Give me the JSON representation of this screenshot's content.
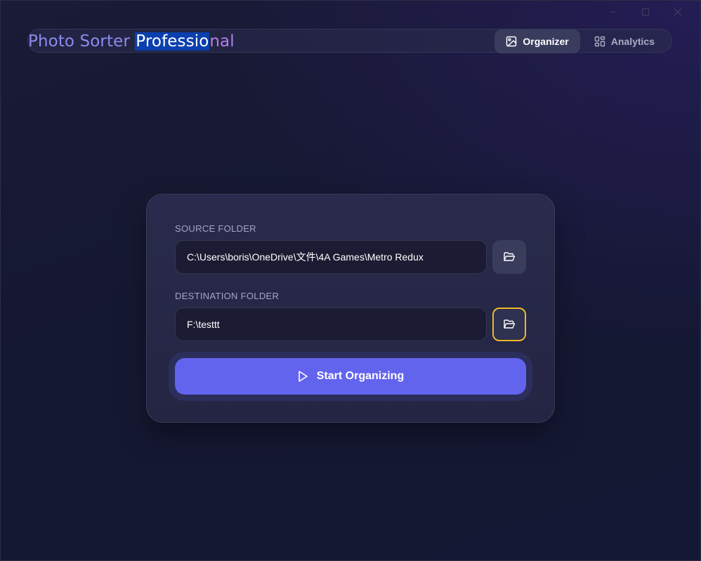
{
  "window": {
    "controls": [
      "minimize",
      "maximize",
      "close"
    ]
  },
  "header": {
    "title_part1": "Photo Sorter ",
    "title_selected": "Professio",
    "title_part3": "nal",
    "tabs": [
      {
        "label": "Organizer",
        "icon": "image-icon",
        "active": true
      },
      {
        "label": "Analytics",
        "icon": "dashboard-icon",
        "active": false
      }
    ]
  },
  "form": {
    "source_label": "SOURCE FOLDER",
    "source_value": "C:\\Users\\boris\\OneDrive\\文件\\4A Games\\Metro Redux",
    "destination_label": "DESTINATION FOLDER",
    "destination_value": "F:\\testtt",
    "browse_icon": "folder-open-icon",
    "start_label": "Start Organizing",
    "start_icon": "play-icon"
  },
  "colors": {
    "accent": "#6264ee",
    "focus_ring": "#f2b72e",
    "title_start": "#8d8bf0",
    "title_end": "#b57ef0",
    "selection": "#0a3fad"
  }
}
